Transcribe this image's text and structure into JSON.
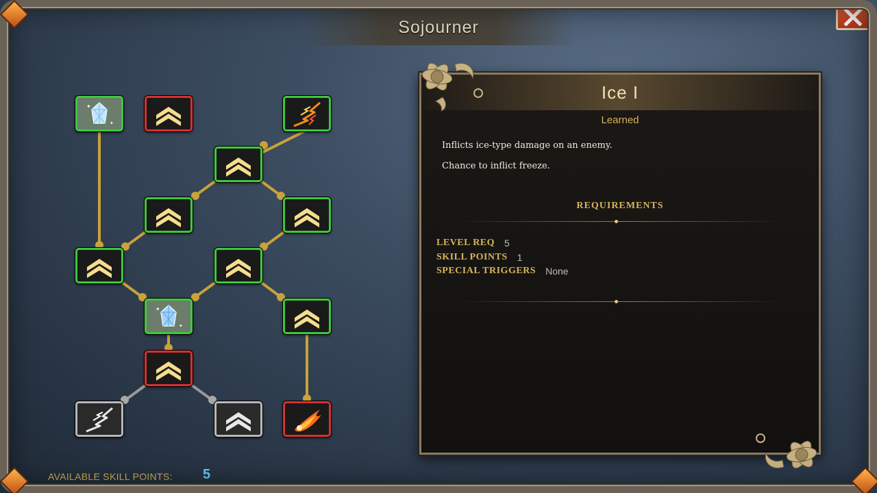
{
  "window": {
    "title": "Sojourner",
    "close_icon": "close-x-icon"
  },
  "tree": {
    "available_points_label": "AVAILABLE SKILL POINTS:",
    "available_points": "5",
    "nodes": [
      {
        "id": "ice-1",
        "icon": "ice-crystal-icon",
        "state": "learned"
      },
      {
        "id": "boost-top",
        "icon": "chevron-up-icon",
        "state": "locked"
      },
      {
        "id": "lightning-1",
        "icon": "lightning-icon",
        "state": "learned"
      },
      {
        "id": "boost-a",
        "icon": "chevron-up-icon",
        "state": "learned"
      },
      {
        "id": "boost-b",
        "icon": "chevron-up-icon",
        "state": "learned"
      },
      {
        "id": "boost-c",
        "icon": "chevron-up-icon",
        "state": "learned"
      },
      {
        "id": "boost-d",
        "icon": "chevron-up-icon",
        "state": "learned"
      },
      {
        "id": "boost-e",
        "icon": "chevron-up-icon",
        "state": "learned"
      },
      {
        "id": "ice-2",
        "icon": "ice-crystal-icon",
        "state": "learned"
      },
      {
        "id": "boost-f",
        "icon": "chevron-up-icon",
        "state": "learned"
      },
      {
        "id": "boost-g",
        "icon": "chevron-up-icon",
        "state": "locked"
      },
      {
        "id": "lightning-2",
        "icon": "lightning-icon",
        "state": "inactive"
      },
      {
        "id": "boost-h",
        "icon": "chevron-up-icon",
        "state": "inactive"
      },
      {
        "id": "fire-1",
        "icon": "fireball-icon",
        "state": "locked"
      }
    ]
  },
  "details": {
    "name": "Ice I",
    "status": "Learned",
    "description": [
      "Inflicts ice-type damage on an enemy.",
      "Chance to inflict freeze."
    ],
    "requirements_heading": "REQUIREMENTS",
    "requirements": {
      "level_label": "LEVEL REQ",
      "level_value": "5",
      "points_label": "SKILL POINTS",
      "points_value": "1",
      "special_label": "SPECIAL TRIGGERS",
      "special_value": "None"
    }
  },
  "colors": {
    "learned_border": "#3ec93e",
    "locked_border": "#d83030",
    "inactive_border": "#b8b8b8",
    "connector": "#c9a23a",
    "accent_gold": "#d5b45a",
    "points_value": "#5fd0ff"
  }
}
